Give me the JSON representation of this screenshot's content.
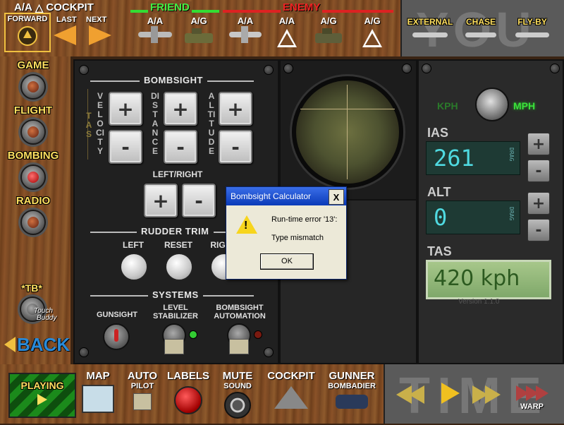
{
  "top_bar": {
    "aa_label": "A/A",
    "cockpit_label": "COCKPIT",
    "forward_label": "FORWARD",
    "last_label": "LAST",
    "next_label": "NEXT",
    "friend_label": "FRIEND",
    "enemy_label": "ENEMY",
    "friend_items": [
      {
        "label": "A/A"
      },
      {
        "label": "A/G"
      }
    ],
    "enemy_items": [
      {
        "label": "A/A"
      },
      {
        "label": "A/A"
      },
      {
        "label": "A/G"
      },
      {
        "label": "A/G"
      }
    ],
    "you_label": "YOU",
    "views": [
      {
        "label": "EXTERNAL"
      },
      {
        "label": "CHASE"
      },
      {
        "label": "FLY-BY"
      }
    ]
  },
  "left_nav": {
    "items": [
      {
        "label": "GAME"
      },
      {
        "label": "FLIGHT"
      },
      {
        "label": "BOMBING"
      },
      {
        "label": "RADIO"
      }
    ],
    "tb_label": "*TB*",
    "touch_buddy_line1": "Touch",
    "touch_buddy_line2": "Buddy",
    "back_label": "BACK"
  },
  "bombsight": {
    "title": "BOMBSIGHT",
    "tas_vertical": "TAS",
    "velocity_vertical": "VELOCITY",
    "distance_vertical": "DISTANCE",
    "altitude_vertical": "ALTITUDE",
    "plus": "+",
    "minus": "-",
    "left_right_label": "LEFT/RIGHT",
    "rudder_trim_title": "RUDDER TRIM",
    "rudder_left": "LEFT",
    "rudder_reset": "RESET",
    "rudder_right": "RIGHT",
    "systems_title": "SYSTEMS",
    "gunsight_label": "GUNSIGHT",
    "level_label_1": "LEVEL",
    "level_label_2": "STABILIZER",
    "automation_label_1": "BOMBSIGHT",
    "automation_label_2": "AUTOMATION"
  },
  "instruments": {
    "kph": "KPH",
    "mph": "MPH",
    "ias_label": "IAS",
    "ias_value": "261",
    "alt_label": "ALT",
    "alt_value": "0",
    "drag_label": "DRAG",
    "tas_label": "TAS",
    "tas_value": "420 kph",
    "version": "Version 1.1.0"
  },
  "dialog": {
    "title": "Bombsight Calculator",
    "close_glyph": "X",
    "line1": "Run-time error '13':",
    "line2": "Type mismatch",
    "ok_label": "OK",
    "warning_glyph": "!"
  },
  "bottom_bar": {
    "playing_label": "PLAYING",
    "map_label": "MAP",
    "auto_label": "AUTO",
    "pilot_label": "PILOT",
    "labels_label": "LABELS",
    "mute_label": "MUTE",
    "sound_label": "SOUND",
    "cockpit_label": "COCKPIT",
    "gunner_label": "GUNNER",
    "bombadier_label": "BOMBADIER",
    "time_label": "TIME",
    "warp_label": "WARP"
  },
  "colors": {
    "accent_yellow": "#ffe060",
    "friend_green": "#33dd33",
    "enemy_red": "#dd2222",
    "lcd_cyan": "#4fd9e0",
    "tas_green": "#2c5a20"
  }
}
